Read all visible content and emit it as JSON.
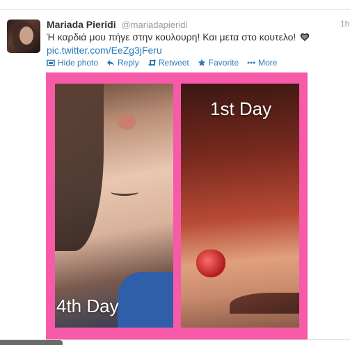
{
  "tweet": {
    "author_name": "Mariada Pieridi",
    "handle": "@mariadapieridi",
    "timestamp": "1h",
    "text": "Ή καρδιά μου πήγε στην κουλουρη! Και μετα στο κουτελο!",
    "link": "pic.twitter.com/EeZg3jFeru"
  },
  "actions": {
    "hide_photo": "Hide photo",
    "reply": "Reply",
    "retweet": "Retweet",
    "favorite": "Favorite",
    "more": "More"
  },
  "media": {
    "frame_color": "#f75aa8",
    "caption_left": "4th Day",
    "caption_right": "1st Day"
  },
  "colors": {
    "link": "#2b7bb9",
    "text": "#333333",
    "muted": "#999999"
  }
}
